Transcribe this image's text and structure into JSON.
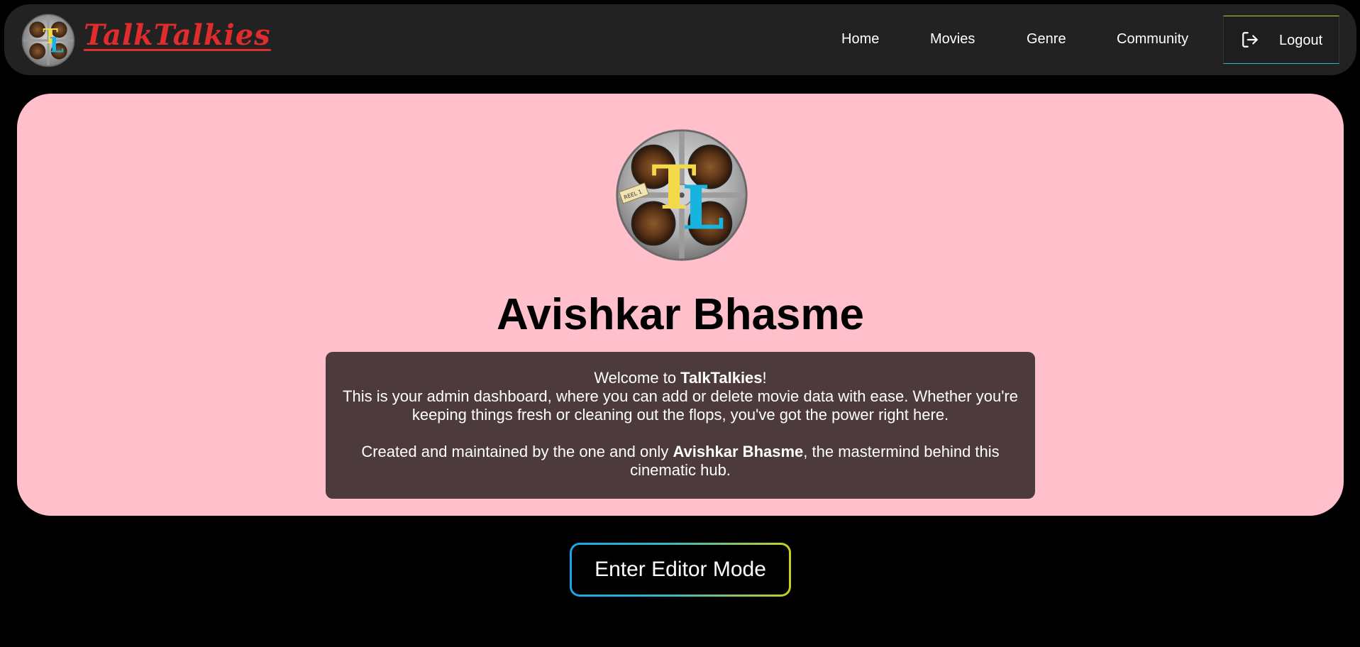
{
  "navbar": {
    "brand": "TalkTalkies",
    "links": [
      "Home",
      "Movies",
      "Genre",
      "Community"
    ],
    "logout_label": "Logout"
  },
  "profile": {
    "logo_reel_tag": "REEL 1",
    "logo_letters": "TL",
    "name": "Avishkar Bhasme",
    "welcome": {
      "line1_prefix": "Welcome to ",
      "line1_brand": "TalkTalkies",
      "line1_suffix": "!",
      "line2": "This is your admin dashboard, where you can add or delete movie data with ease. Whether you're keeping things fresh or cleaning out the flops, you've got the power right here.",
      "line3_prefix": "Created and maintained by the one and only ",
      "line3_name": "Avishkar Bhasme",
      "line3_suffix": ", the mastermind behind this cinematic hub."
    }
  },
  "editor_button_label": "Enter Editor Mode",
  "colors": {
    "brand_red": "#e02c2c",
    "card_pink": "#ffbfcb",
    "welcome_box": "#4d3a3d",
    "logo_yellow": "#f3da4a",
    "logo_cyan": "#17b4e0"
  }
}
